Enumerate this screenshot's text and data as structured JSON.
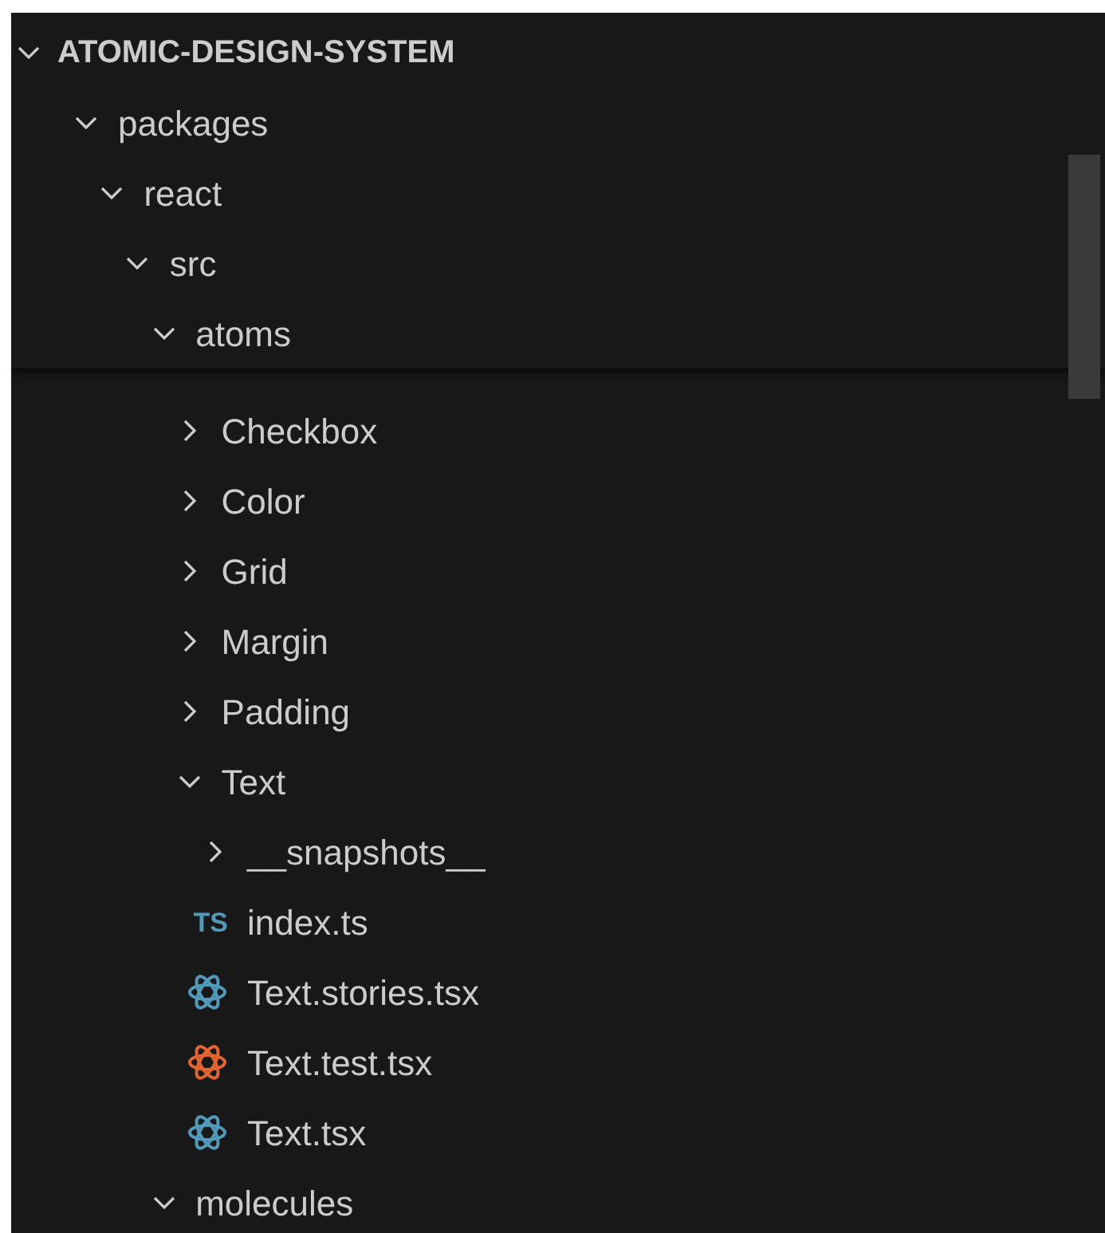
{
  "explorer": {
    "root": {
      "label": "ATOMIC-DESIGN-SYSTEM",
      "expanded": true
    },
    "tree": [
      {
        "kind": "folder",
        "label": "packages",
        "expanded": true,
        "children": [
          {
            "kind": "folder",
            "label": "react",
            "expanded": true,
            "children": [
              {
                "kind": "folder",
                "label": "src",
                "expanded": true,
                "children": [
                  {
                    "kind": "folder",
                    "label": "atoms",
                    "expanded": true,
                    "children": [
                      {
                        "kind": "folder",
                        "label": "Checkbox",
                        "expanded": false
                      },
                      {
                        "kind": "folder",
                        "label": "Color",
                        "expanded": false
                      },
                      {
                        "kind": "folder",
                        "label": "Grid",
                        "expanded": false
                      },
                      {
                        "kind": "folder",
                        "label": "Margin",
                        "expanded": false
                      },
                      {
                        "kind": "folder",
                        "label": "Padding",
                        "expanded": false
                      },
                      {
                        "kind": "folder",
                        "label": "Text",
                        "expanded": true,
                        "children": [
                          {
                            "kind": "folder",
                            "label": "__snapshots__",
                            "expanded": false
                          },
                          {
                            "kind": "ts",
                            "label": "index.ts",
                            "badge": "TS"
                          },
                          {
                            "kind": "react",
                            "label": "Text.stories.tsx",
                            "color": "#519aba"
                          },
                          {
                            "kind": "react",
                            "label": "Text.test.tsx",
                            "color": "#e2652f"
                          },
                          {
                            "kind": "react",
                            "label": "Text.tsx",
                            "color": "#519aba"
                          }
                        ]
                      }
                    ]
                  },
                  {
                    "kind": "folder",
                    "label": "molecules",
                    "expanded": true
                  }
                ]
              }
            ]
          }
        ]
      }
    ]
  }
}
